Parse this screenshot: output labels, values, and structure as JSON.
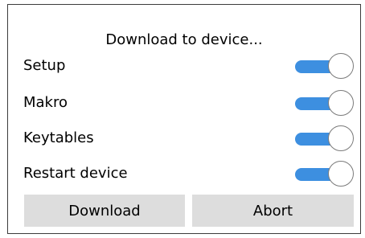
{
  "dialog": {
    "title": "Download to device..."
  },
  "options": [
    {
      "label": "Setup",
      "enabled": true
    },
    {
      "label": "Makro",
      "enabled": true
    },
    {
      "label": "Keytables",
      "enabled": true
    },
    {
      "label": "Restart device",
      "enabled": true
    }
  ],
  "buttons": {
    "download_label": "Download",
    "abort_label": "Abort"
  },
  "colors": {
    "toggle_on": "#3d8fe0",
    "button_bg": "#dddddd",
    "border": "#3c3c3c"
  }
}
